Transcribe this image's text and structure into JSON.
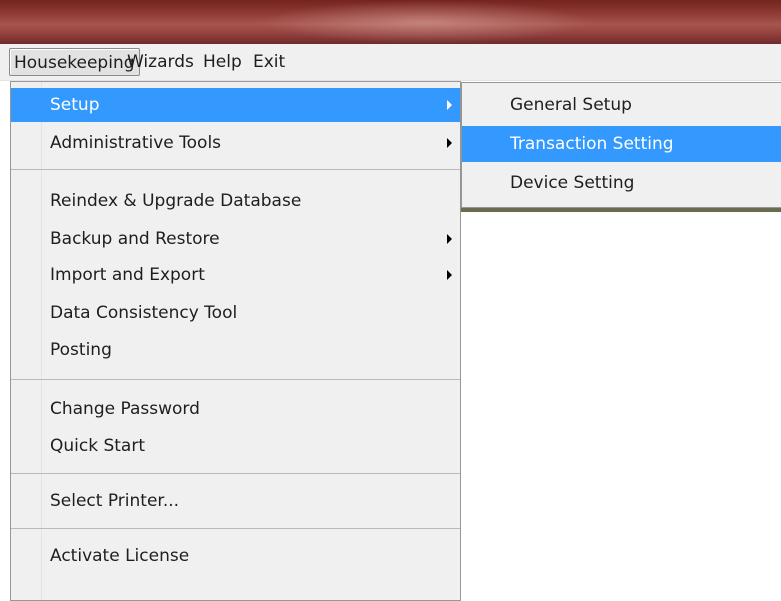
{
  "menubar": {
    "items": [
      "Housekeeping",
      "Wizards",
      "Help",
      "Exit"
    ]
  },
  "housekeeping_menu": {
    "items": [
      {
        "label": "Setup",
        "has_submenu": true,
        "highlighted": true
      },
      {
        "label": "Administrative Tools",
        "has_submenu": true
      },
      {
        "label": "Reindex & Upgrade Database"
      },
      {
        "label": "Backup and Restore",
        "has_submenu": true
      },
      {
        "label": "Import and Export",
        "has_submenu": true
      },
      {
        "label": "Data Consistency Tool"
      },
      {
        "label": "Posting"
      },
      {
        "label": "Change Password"
      },
      {
        "label": "Quick Start"
      },
      {
        "label": "Select Printer..."
      },
      {
        "label": "Activate License"
      }
    ]
  },
  "setup_submenu": {
    "items": [
      {
        "label": "General Setup"
      },
      {
        "label": "Transaction Setting",
        "highlighted": true
      },
      {
        "label": "Device Setting"
      }
    ]
  },
  "colors": {
    "highlight": "#3399ff",
    "menu_bg": "#f0f0f0",
    "titlebar": "#8f3a34"
  }
}
